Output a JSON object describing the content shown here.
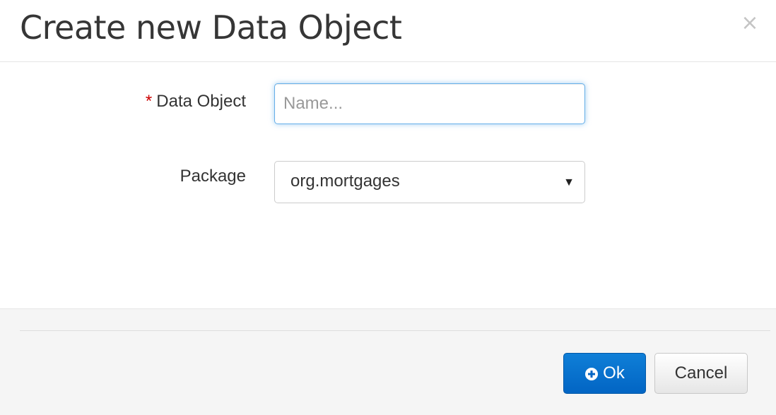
{
  "dialog": {
    "title": "Create new Data Object",
    "close_glyph": "×"
  },
  "form": {
    "data_object": {
      "required_marker": "*",
      "label": "Data Object",
      "value": "",
      "placeholder": "Name..."
    },
    "package": {
      "label": "Package",
      "selected": "org.mortgages",
      "caret_glyph": "▼"
    }
  },
  "footer": {
    "ok_label": "Ok",
    "ok_icon": "plus-circle-icon",
    "cancel_label": "Cancel"
  },
  "colors": {
    "primary": "#0265c4",
    "required": "#cc0000",
    "footer_bg": "#f5f5f5",
    "focus_border": "#66afe9"
  }
}
